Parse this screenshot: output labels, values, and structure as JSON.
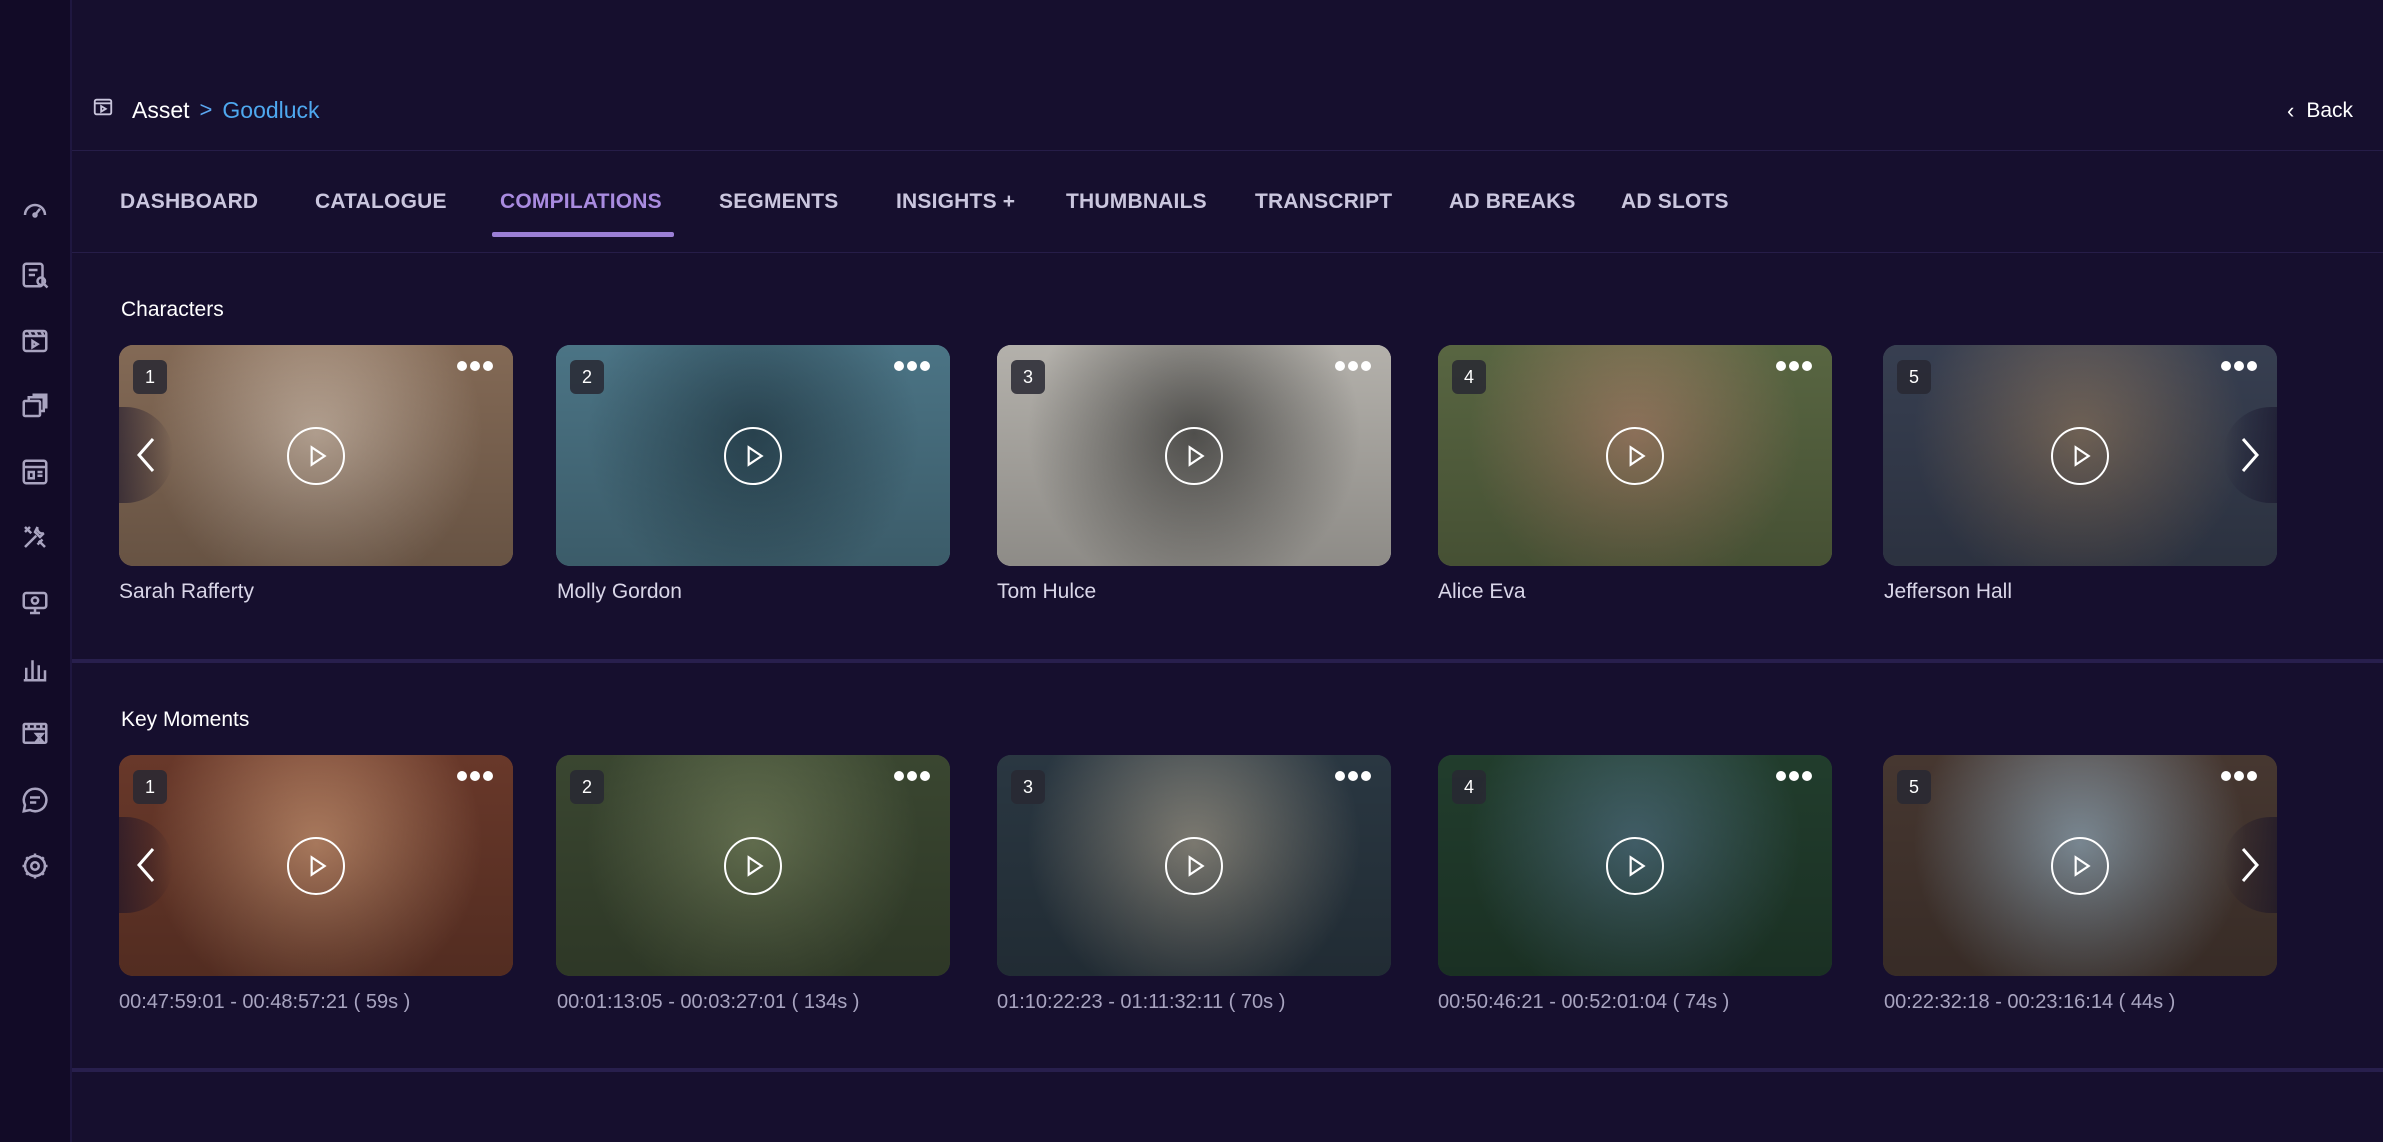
{
  "breadcrumb": {
    "root": "Asset",
    "separator": ">",
    "current": "Goodluck"
  },
  "back_label": "Back",
  "tabs": [
    {
      "label": "DASHBOARD"
    },
    {
      "label": "CATALOGUE"
    },
    {
      "label": "COMPILATIONS"
    },
    {
      "label": "SEGMENTS"
    },
    {
      "label": "INSIGHTS +"
    },
    {
      "label": "THUMBNAILS"
    },
    {
      "label": "TRANSCRIPT"
    },
    {
      "label": "AD BREAKS"
    },
    {
      "label": "AD SLOTS"
    }
  ],
  "active_tab": "COMPILATIONS",
  "sidebar_icons": [
    "dashboard-gauge-icon",
    "search-list-icon",
    "video-clip-icon",
    "media-stack-icon",
    "layout-icon",
    "tools-icon",
    "monitor-settings-icon",
    "bar-chart-icon",
    "film-schedule-icon",
    "chat-icon",
    "settings-gear-icon"
  ],
  "characters": {
    "title": "Characters",
    "items": [
      {
        "index": "1",
        "name": "Sarah Rafferty",
        "tone": [
          "#8a6f5a",
          "#c9b4a2"
        ]
      },
      {
        "index": "2",
        "name": "Molly Gordon",
        "tone": [
          "#4f7a8c",
          "#2e4b59"
        ]
      },
      {
        "index": "3",
        "name": "Tom Hulce",
        "tone": [
          "#bdbab4",
          "#5b5a57"
        ]
      },
      {
        "index": "4",
        "name": "Alice Eva",
        "tone": [
          "#5d6b45",
          "#a08066"
        ]
      },
      {
        "index": "5",
        "name": "Jefferson Hall",
        "tone": [
          "#3a4255",
          "#7e6e60"
        ]
      }
    ]
  },
  "key_moments": {
    "title": "Key Moments",
    "items": [
      {
        "index": "1",
        "time": "00:47:59:01 - 00:48:57:21 ( 59s )",
        "tone": [
          "#6e3b2c",
          "#c08a6a"
        ]
      },
      {
        "index": "2",
        "time": "00:01:13:05 - 00:03:27:01 ( 134s )",
        "tone": [
          "#3d4a33",
          "#6e7b58"
        ]
      },
      {
        "index": "3",
        "time": "01:10:22:23 - 01:11:32:11 ( 70s )",
        "tone": [
          "#2c3a45",
          "#8d8a80"
        ]
      },
      {
        "index": "4",
        "time": "00:50:46:21 - 00:52:01:04 ( 74s )",
        "tone": [
          "#23402f",
          "#4a6a75"
        ]
      },
      {
        "index": "5",
        "time": "00:22:32:18 - 00:23:16:14 ( 44s )",
        "tone": [
          "#4a3a33",
          "#8a9aa6"
        ]
      }
    ]
  },
  "colors": {
    "background": "#160f2e",
    "accent": "#9b7fd6",
    "link": "#4ea8ef"
  }
}
